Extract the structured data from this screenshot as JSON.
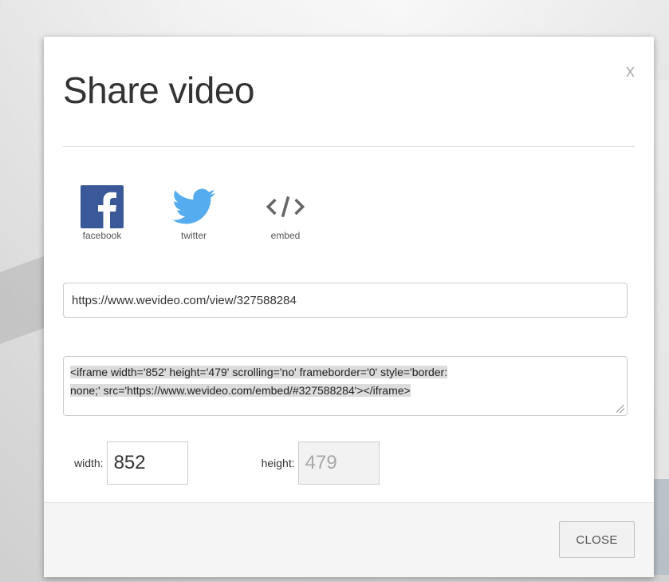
{
  "dialog": {
    "title": "Share video",
    "close_x": "x"
  },
  "share": {
    "items": [
      {
        "label": "facebook",
        "icon": "facebook-icon",
        "color": "#3b5998"
      },
      {
        "label": "twitter",
        "icon": "twitter-icon",
        "color": "#55acee"
      },
      {
        "label": "embed",
        "icon": "embed-code-icon",
        "color": "#666666"
      }
    ]
  },
  "link": {
    "value": "https://www.wevideo.com/view/327588284"
  },
  "embed": {
    "code_line1": "<iframe width='852' height='479' scrolling='no' frameborder='0' style='border:",
    "code_line2": "none;' src='https://www.wevideo.com/embed/#327588284'></iframe>"
  },
  "dimensions": {
    "width_label": "width:",
    "width_value": "852",
    "height_label": "height:",
    "height_value": "479"
  },
  "footer": {
    "close_label": "CLOSE"
  }
}
